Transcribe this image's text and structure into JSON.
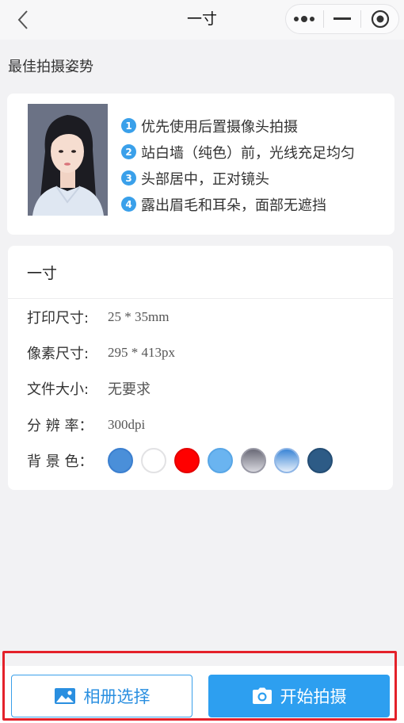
{
  "navbar": {
    "title": "一寸",
    "back_icon": "chevron-left-icon",
    "more_icon": "more-dots-icon",
    "minimize_icon": "minus-icon",
    "close_icon": "target-circle-icon"
  },
  "guide": {
    "section_title": "最佳拍摄姿势",
    "tips": [
      {
        "num": "1",
        "text": "优先使用后置摄像头拍摄"
      },
      {
        "num": "2",
        "text": "站白墙（纯色）前，光线充足均匀"
      },
      {
        "num": "3",
        "text": "头部居中，正对镜头"
      },
      {
        "num": "4",
        "text": "露出眉毛和耳朵，面部无遮挡"
      }
    ]
  },
  "spec": {
    "title": "一寸",
    "print_size_label": "打印尺寸:",
    "print_size_value": "25 * 35mm",
    "pixel_size_label": "像素尺寸:",
    "pixel_size_value": "295 * 413px",
    "file_size_label": "文件大小:",
    "file_size_value": "无要求",
    "resolution_label": "分 辨 率：",
    "resolution_value": "300dpi",
    "background_label": "背 景 色：",
    "background_colors": [
      "#4a8fd9",
      "#ffffff",
      "#ff0000",
      "#6ab4f0",
      "gradient-gray",
      "gradient-blue",
      "#2d5b86"
    ]
  },
  "actions": {
    "album_label": "相册选择",
    "album_icon": "image-icon",
    "shoot_label": "开始拍摄",
    "shoot_icon": "camera-icon"
  },
  "colors": {
    "accent": "#2d9ff0",
    "highlight": "#e4212a"
  }
}
